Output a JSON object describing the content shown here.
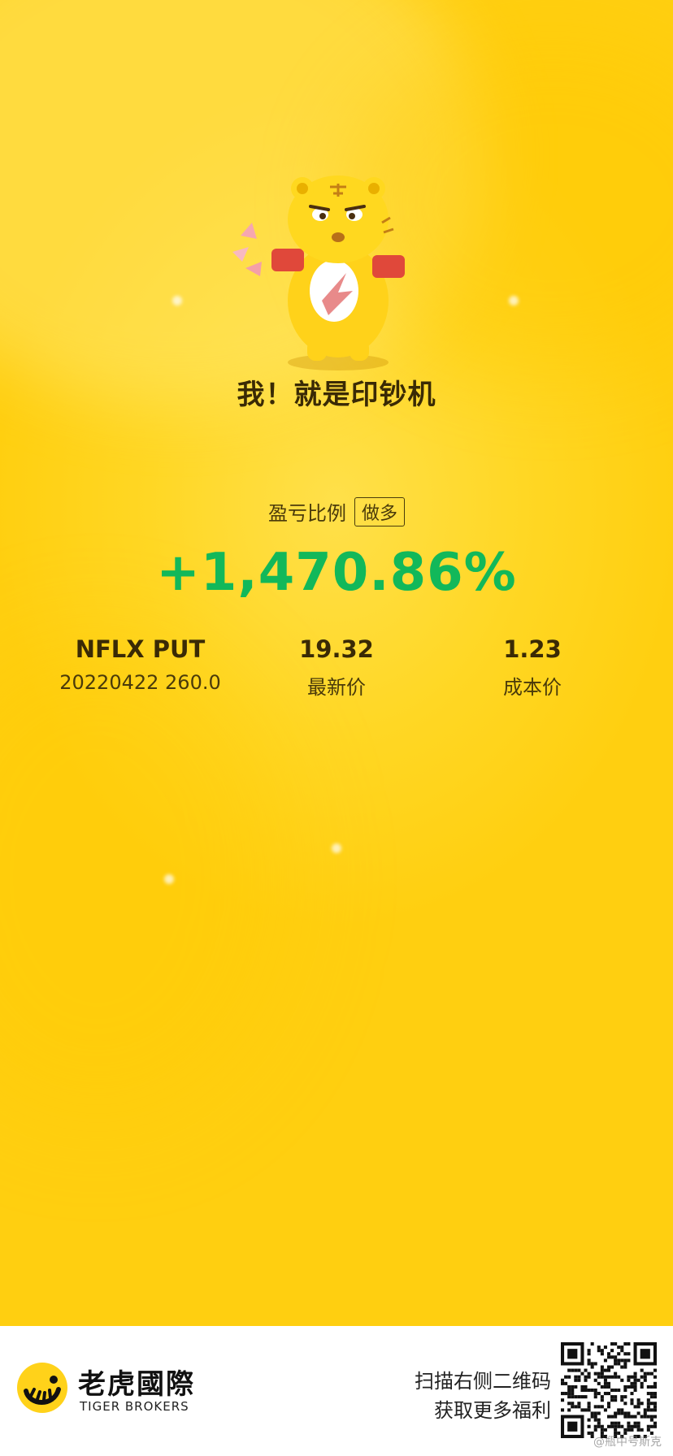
{
  "poster": {
    "slogan": "我！就是印钞机",
    "ratio_label": "盈亏比例",
    "direction_badge": "做多",
    "pnl_percent": "+1,470.86%"
  },
  "position": {
    "symbol": "NFLX PUT",
    "contract": "20220422  260.0",
    "last_price": "19.32",
    "last_price_label": "最新价",
    "cost_price": "1.23",
    "cost_price_label": "成本价"
  },
  "footer": {
    "brand_cn": "老虎國際",
    "brand_en": "TIGER BROKERS",
    "scan_line1": "扫描右侧二维码",
    "scan_line2": "获取更多福利",
    "watermark": "@瓶中号斯克"
  },
  "colors": {
    "background": "#ffd724",
    "profit_green": "#12b85a",
    "text_dark": "#3a2a05"
  },
  "icons": [
    "tiger-mascot-icon",
    "tiger-logo-icon",
    "qr-code-icon"
  ]
}
